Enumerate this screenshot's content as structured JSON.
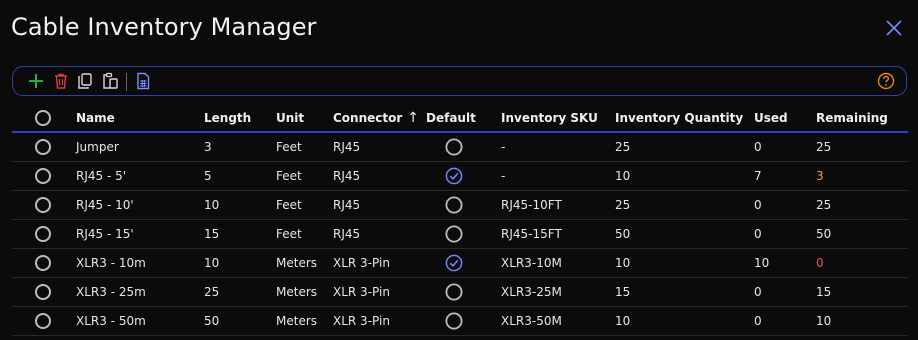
{
  "window": {
    "title": "Cable Inventory Manager"
  },
  "toolbar": {
    "icons": [
      "add-icon",
      "delete-icon",
      "copy-icon",
      "paste-icon",
      "export-spreadsheet-icon",
      "help-icon"
    ],
    "colors": {
      "border": "#2f3fa8",
      "add": "#2fa84a",
      "delete": "#d33d3d",
      "help": "#e08a1f"
    }
  },
  "table": {
    "columns": {
      "name": "Name",
      "length": "Length",
      "unit": "Unit",
      "connector": "Connector",
      "default": "Default",
      "sku": "Inventory SKU",
      "quantity": "Inventory Quantity",
      "used": "Used",
      "remaining": "Remaining"
    },
    "sort": {
      "column": "connector",
      "direction": "ascending",
      "icon": "arrow-up-icon"
    },
    "rows": [
      {
        "name": "Jumper",
        "length": "3",
        "unit": "Feet",
        "connector": "RJ45",
        "default": false,
        "sku": "-",
        "quantity": "25",
        "used": "0",
        "remaining": "25",
        "remaining_status": "normal"
      },
      {
        "name": "RJ45 - 5'",
        "length": "5",
        "unit": "Feet",
        "connector": "RJ45",
        "default": true,
        "sku": "-",
        "quantity": "10",
        "used": "7",
        "remaining": "3",
        "remaining_status": "low"
      },
      {
        "name": "RJ45 - 10'",
        "length": "10",
        "unit": "Feet",
        "connector": "RJ45",
        "default": false,
        "sku": "RJ45-10FT",
        "quantity": "25",
        "used": "0",
        "remaining": "25",
        "remaining_status": "normal"
      },
      {
        "name": "RJ45 - 15'",
        "length": "15",
        "unit": "Feet",
        "connector": "RJ45",
        "default": false,
        "sku": "RJ45-15FT",
        "quantity": "50",
        "used": "0",
        "remaining": "50",
        "remaining_status": "normal"
      },
      {
        "name": "XLR3 - 10m",
        "length": "10",
        "unit": "Meters",
        "connector": "XLR 3-Pin",
        "default": true,
        "sku": "XLR3-10M",
        "quantity": "10",
        "used": "10",
        "remaining": "0",
        "remaining_status": "empty"
      },
      {
        "name": "XLR3 - 25m",
        "length": "25",
        "unit": "Meters",
        "connector": "XLR 3-Pin",
        "default": false,
        "sku": "XLR3-25M",
        "quantity": "15",
        "used": "0",
        "remaining": "15",
        "remaining_status": "normal"
      },
      {
        "name": "XLR3 - 50m",
        "length": "50",
        "unit": "Meters",
        "connector": "XLR 3-Pin",
        "default": false,
        "sku": "XLR3-50M",
        "quantity": "10",
        "used": "0",
        "remaining": "10",
        "remaining_status": "normal"
      }
    ],
    "status_colors": {
      "low": "#f0a040",
      "empty": "#e05050",
      "default_check": "#6f84ff"
    }
  }
}
